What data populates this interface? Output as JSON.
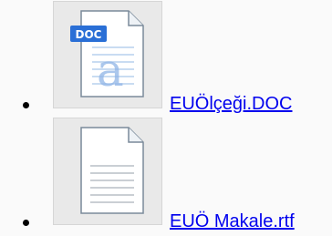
{
  "attachments": [
    {
      "file_name": "EUÖlçeği.DOC",
      "icon": "word-doc-icon",
      "badge": "DOC",
      "glyph": "a"
    },
    {
      "file_name": "EUÖ Makale.rtf",
      "icon": "text-document-icon"
    }
  ],
  "colors": {
    "link": "#0000ee",
    "doc_badge": "#2a6fd6",
    "thumb_bg": "#e9e9e9",
    "page_bg": "#fafafa"
  }
}
